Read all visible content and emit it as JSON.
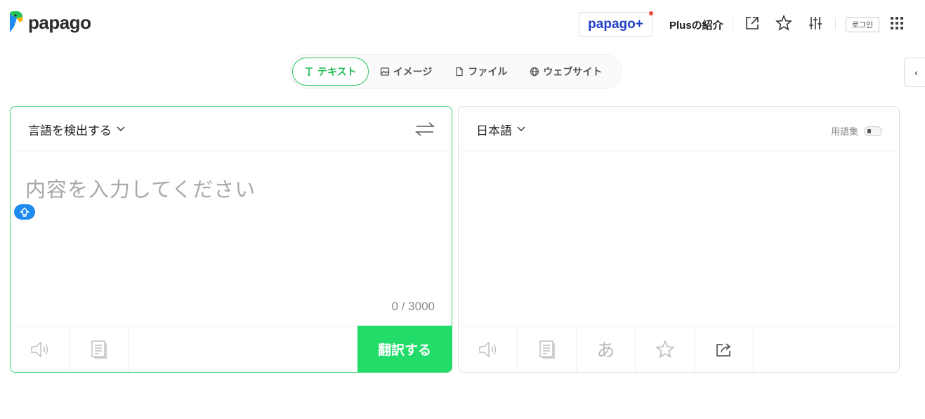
{
  "header": {
    "logo_text": "papago",
    "plus_button": "papago+",
    "plus_intro": "Plusの紹介",
    "login": "로그인"
  },
  "tabs": [
    {
      "label": "テキスト",
      "icon": "text-icon",
      "active": true
    },
    {
      "label": "イメージ",
      "icon": "image-icon",
      "active": false
    },
    {
      "label": "ファイル",
      "icon": "file-icon",
      "active": false
    },
    {
      "label": "ウェブサイト",
      "icon": "globe-icon",
      "active": false
    }
  ],
  "source": {
    "language": "言語を検出する",
    "placeholder": "内容を入力してください",
    "counter": "0 / 3000",
    "translate_button": "翻訳する"
  },
  "target": {
    "language": "日本語",
    "glossary_label": "用語集",
    "hiragana_glyph": "あ"
  },
  "colors": {
    "accent_green": "#22dc6a",
    "border_green": "#3ad170",
    "brand_blue": "#1f3fc7",
    "notify_red": "#f0493e",
    "keyboard_blue": "#1d8af0"
  }
}
